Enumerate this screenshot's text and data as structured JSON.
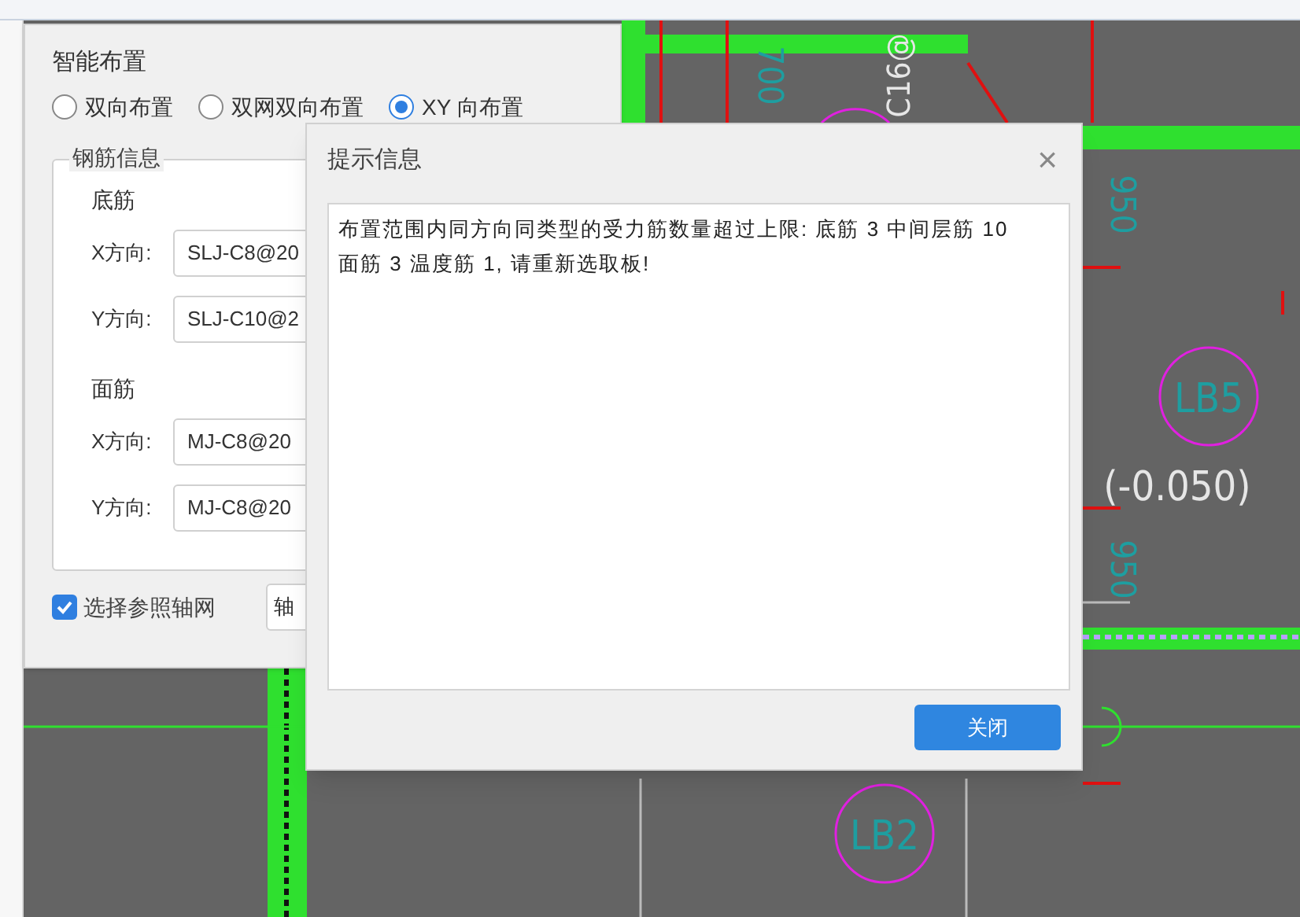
{
  "canvas": {
    "labels": [
      {
        "kind": "slab",
        "text": "LB5"
      },
      {
        "kind": "elevation",
        "text": "(-0.050)"
      },
      {
        "kind": "dimension",
        "text": "950"
      },
      {
        "kind": "dimension",
        "text": "950"
      },
      {
        "kind": "dimension",
        "text": "700"
      },
      {
        "kind": "rebar",
        "text": "C16@"
      },
      {
        "kind": "slab",
        "text": "LB2"
      }
    ]
  },
  "layout_dialog": {
    "title": "智能布置",
    "modes": [
      {
        "label": "双向布置",
        "selected": false
      },
      {
        "label": "双网双向布置",
        "selected": false
      },
      {
        "label": "XY 向布置",
        "selected": true
      }
    ],
    "group_title": "钢筋信息",
    "sections": [
      {
        "title": "底筋",
        "fields": [
          {
            "label": "X方向:",
            "value": "SLJ-C8@20"
          },
          {
            "label": "Y方向:",
            "value": "SLJ-C10@2"
          }
        ]
      },
      {
        "title": "面筋",
        "fields": [
          {
            "label": "X方向:",
            "value": "MJ-C8@20"
          },
          {
            "label": "Y方向:",
            "value": "MJ-C8@20"
          }
        ]
      }
    ],
    "reference_grid": {
      "label": "选择参照轴网",
      "checked": true
    },
    "grid_button": "轴"
  },
  "message_dialog": {
    "title": "提示信息",
    "close_glyph": "×",
    "message": "布置范围内同方向同类型的受力筋数量超过上限: 底筋 3 中间层筋 10 面筋 3 温度筋 1, 请重新选取板!",
    "button": "关闭"
  }
}
